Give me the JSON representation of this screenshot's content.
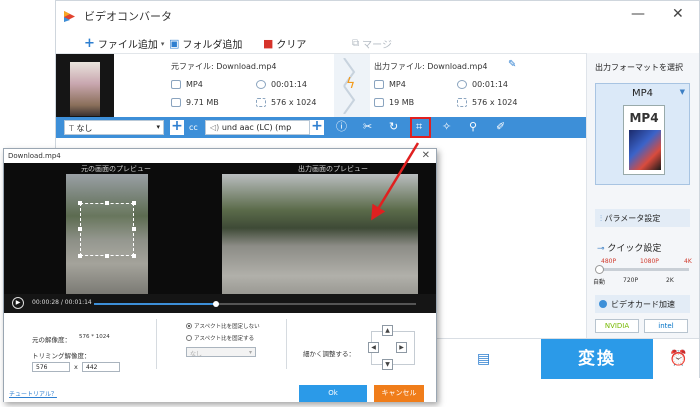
{
  "main": {
    "title": "ビデオコンバータ",
    "window_controls": {
      "minimize": "—",
      "close": "✕"
    },
    "toolbar": {
      "add_file": "ファイル追加",
      "add_folder": "フォルダ追加",
      "clear": "クリア",
      "merge": "マージ"
    },
    "source": {
      "label": "元ファイル: Download.mp4",
      "format": "MP4",
      "duration": "00:01:14",
      "size": "9.71 MB",
      "resolution": "576 x 1024"
    },
    "output": {
      "label": "出力ファイル: Download.mp4",
      "format": "MP4",
      "duration": "00:01:14",
      "size": "19 MB",
      "resolution": "576 x 1024"
    },
    "editbar": {
      "subtitle": "なし",
      "cc": "cc",
      "audio": "und aac (LC) (mp"
    },
    "right_panel": {
      "header": "出力フォーマットを選択",
      "format": "MP4",
      "format_icon_text": "MP4",
      "params": "パラメータ設定",
      "quick": "クイック設定",
      "ticks_top": [
        "480P",
        "1080P",
        "4K"
      ],
      "ticks_bottom": [
        "自動",
        "720P",
        "2K"
      ],
      "gpu": "ビデオカード加速",
      "nvidia": "NVIDIA",
      "intel": "intel",
      "quality_level": 0
    },
    "convert": "変換"
  },
  "dialog": {
    "title": "Download.mp4",
    "close": "✕",
    "original_preview": "元の画面のプレビュー",
    "output_preview": "出力画面のプレビュー",
    "time": "00:00:28 / 00:01:14",
    "progress": 0.38,
    "orig_res_label": "元の解像度：",
    "orig_res_value": "576 * 1024",
    "trim_label": "トリミング解像度：",
    "width": "576",
    "x": "x",
    "height": "442",
    "aspect_free": "アスペクト比を固定しない",
    "aspect_fixed": "アスペクト比を固定する",
    "aspect_select": "なし",
    "adjust": "細かく調整する：",
    "ok": "Ok",
    "cancel": "キャンセル",
    "tutorial": "チュートリアル？"
  },
  "colors": {
    "accent": "#2b9ae8",
    "bar": "#3d8fd8",
    "cancel": "#f07d1a",
    "highlight": "#e02020"
  }
}
